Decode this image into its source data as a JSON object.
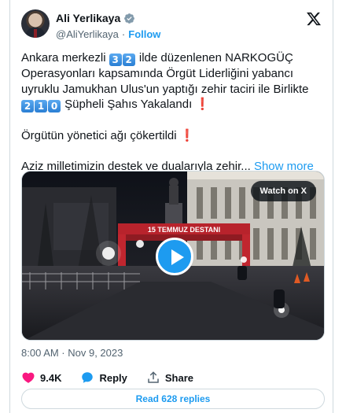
{
  "author": {
    "name": "Ali Yerlikaya",
    "handle": "@AliYerlikaya",
    "separator": "·",
    "follow_label": "Follow"
  },
  "tweet": {
    "line1_a": "Ankara merkezli ",
    "line1_key1": "3",
    "line1_key2": "2",
    "line1_b": " ilde düzenlenen NARKOGÜÇ",
    "line2": "Operasyonları kapsamında Örgüt Liderliğini yabancı",
    "line3": "uyruklu Jamukhan Ulus'un yaptığı zehir taciri ile Birlikte",
    "line4_key1": "2",
    "line4_key2": "1",
    "line4_key3": "0",
    "line4_text": " Şüpheli Şahıs Yakalandı",
    "exclaim": "❗",
    "line5_text": "Örgütün yönetici ağı çökertildi",
    "line6_text": "Aziz milletimizin destek ve dualarıyla zehir... ",
    "show_more": "Show more"
  },
  "media": {
    "watch_label": "Watch on X",
    "banner_text": "15 TEMMUZ DESTANI"
  },
  "timestamp": "8:00 AM · Nov 9, 2023",
  "actions": {
    "likes": "9.4K",
    "reply_label": "Reply",
    "share_label": "Share"
  },
  "read_replies": "Read 628 replies",
  "colors": {
    "accent": "#1d9bf0",
    "like": "#f91880",
    "text": "#0f1419",
    "muted": "#536471",
    "border": "#cfd9de"
  },
  "icons": [
    "verified-badge-icon",
    "x-logo-icon",
    "play-icon",
    "heart-icon",
    "reply-icon",
    "share-icon"
  ]
}
